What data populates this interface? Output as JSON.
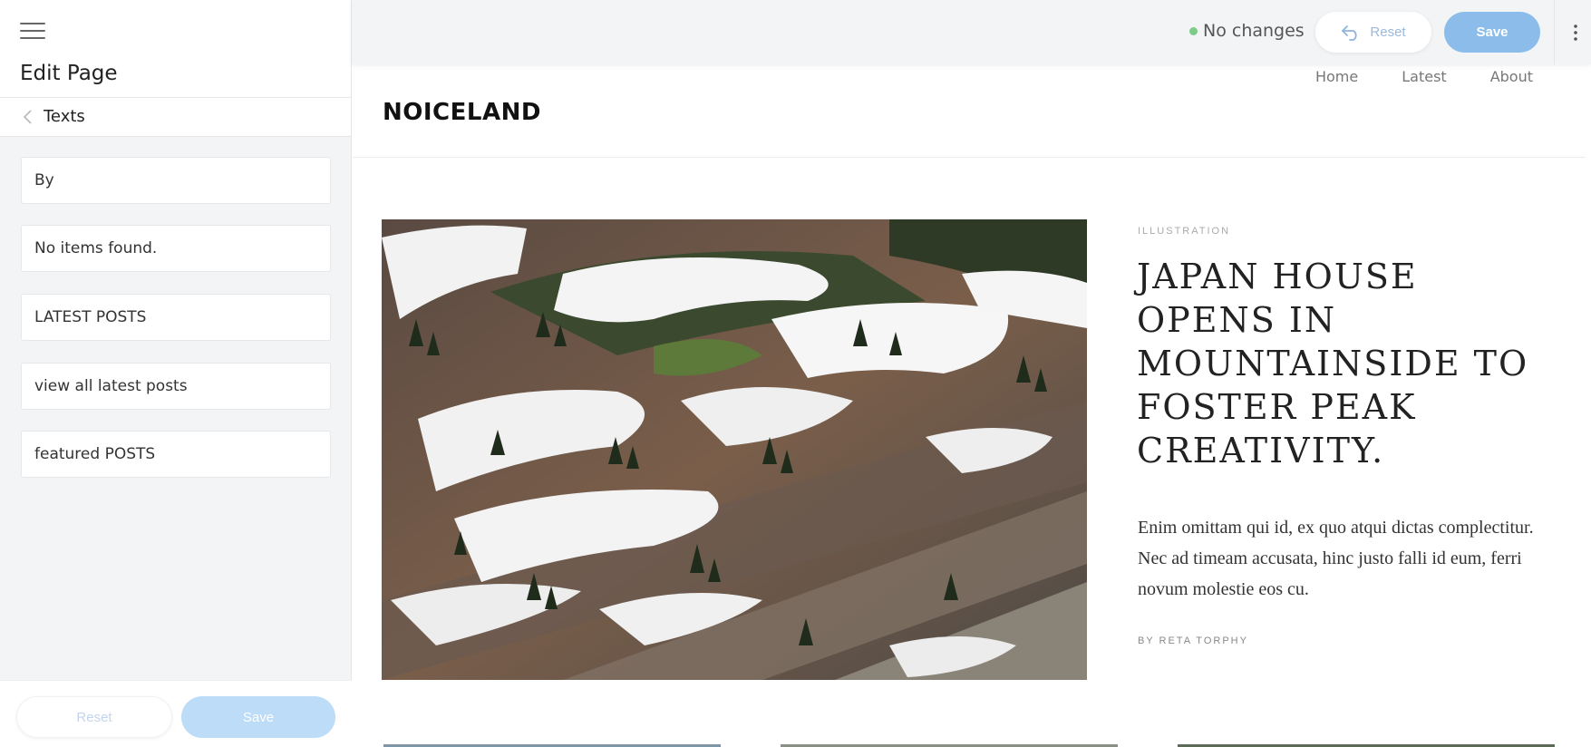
{
  "sidebar": {
    "title": "Edit Page",
    "breadcrumb": "Texts",
    "fields": [
      "By",
      "No items found.",
      "LATEST POSTS",
      "view all latest posts",
      "featured POSTS"
    ],
    "reset_label": "Reset",
    "save_label": "Save"
  },
  "toolbar": {
    "status": "No changes",
    "status_color": "#7ccb86",
    "reset_label": "Reset",
    "save_label": "Save"
  },
  "site": {
    "logo": "NOICELAND",
    "nav": [
      "Home",
      "Latest",
      "About"
    ],
    "featured": {
      "category": "ILLUSTRATION",
      "headline": "JAPAN HOUSE OPENS IN MOUNTAINSIDE TO FOSTER PEAK CREATIVITY.",
      "excerpt": "Enim omittam qui id, ex quo atqui dictas complectitur. Nec ad timeam accusata, hinc justo falli id eum, ferri novum molestie eos cu.",
      "byline": "BY RETA TORPHY"
    }
  },
  "colors": {
    "accent": "#8cbdea",
    "accent_light": "#bcdcf8"
  }
}
